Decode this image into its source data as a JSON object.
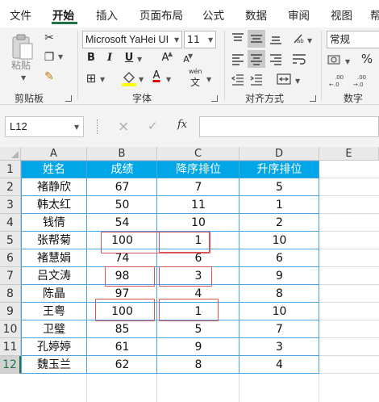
{
  "menu": {
    "tabs": [
      "文件",
      "开始",
      "插入",
      "页面布局",
      "公式",
      "数据",
      "审阅",
      "视图",
      "帮"
    ],
    "active": "开始"
  },
  "ribbon": {
    "clipboard": {
      "paste_label": "粘贴",
      "group_label": "剪贴板"
    },
    "font": {
      "group_label": "字体",
      "font_name": "Microsoft YaHei UI",
      "font_size": "11",
      "bold": "B",
      "italic": "I",
      "underline": "U",
      "grow": "A",
      "shrink": "A",
      "phonetic_top": "wén",
      "phonetic_bottom": "文",
      "font_color": "#e00000",
      "fill_color": "#ffff00"
    },
    "alignment": {
      "group_label": "对齐方式"
    },
    "number": {
      "group_label": "数字",
      "format": "常规"
    }
  },
  "formula_bar": {
    "name_box": "L12",
    "cancel_icon": "×",
    "enter_icon": "✓",
    "fx_label": "fx",
    "formula": ""
  },
  "sheet": {
    "columns": [
      "A",
      "B",
      "C",
      "D",
      "E"
    ],
    "rows": [
      "1",
      "2",
      "3",
      "4",
      "5",
      "6",
      "7",
      "8",
      "9",
      "10",
      "11",
      "12"
    ],
    "selected_row": "12",
    "header": [
      "姓名",
      "成绩",
      "降序排位",
      "升序排位"
    ],
    "data": [
      [
        "褚静欣",
        "67",
        "7",
        "5"
      ],
      [
        "韩太红",
        "50",
        "11",
        "1"
      ],
      [
        "钱倩",
        "54",
        "10",
        "2"
      ],
      [
        "张帮菊",
        "100",
        "1",
        "10"
      ],
      [
        "褚慧娟",
        "74",
        "6",
        "6"
      ],
      [
        "吕文涛",
        "98",
        "3",
        "9"
      ],
      [
        "陈晶",
        "97",
        "4",
        "8"
      ],
      [
        "王粤",
        "100",
        "1",
        "10"
      ],
      [
        "卫璧",
        "85",
        "5",
        "7"
      ],
      [
        "孔婷婷",
        "61",
        "9",
        "3"
      ],
      [
        "魏玉兰",
        "62",
        "8",
        "4"
      ]
    ],
    "header_fill_color": "#00a6e6",
    "highlight_color": "#d9535b"
  }
}
